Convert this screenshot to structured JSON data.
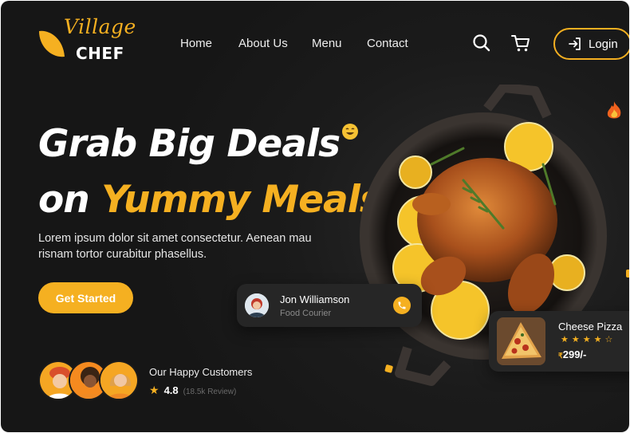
{
  "brand": {
    "script_name": "Village",
    "name": "CHEF"
  },
  "nav": {
    "items": [
      "Home",
      "About Us",
      "Menu",
      "Contact"
    ]
  },
  "header": {
    "search_icon": "search-icon",
    "cart_icon": "cart-icon",
    "login_label": "Login",
    "login_icon": "login-icon"
  },
  "hero": {
    "title_line1": "Grab Big Deals",
    "title_line2_prefix": "on ",
    "title_line2_accent": "Yummy Meals!",
    "description": "Lorem ipsum dolor sit amet consectetur. Aenean mau risnam tortor curabitur phasellus.",
    "cta_label": "Get Started"
  },
  "customers": {
    "label": "Our Happy Customers",
    "star": "★",
    "rating": "4.8",
    "reviews": "(18.5k Review)"
  },
  "courier": {
    "name": "Jon Williamson",
    "role": "Food Courier",
    "call_icon": "phone-icon"
  },
  "dish_card": {
    "name": "Cheese Pizza",
    "stars": "★★★★☆",
    "rating_fraction": 0.8,
    "currency": "₹",
    "price": "299/-"
  },
  "colors": {
    "accent": "#f5b021",
    "background": "#1b1b1b",
    "card": "#262626"
  }
}
